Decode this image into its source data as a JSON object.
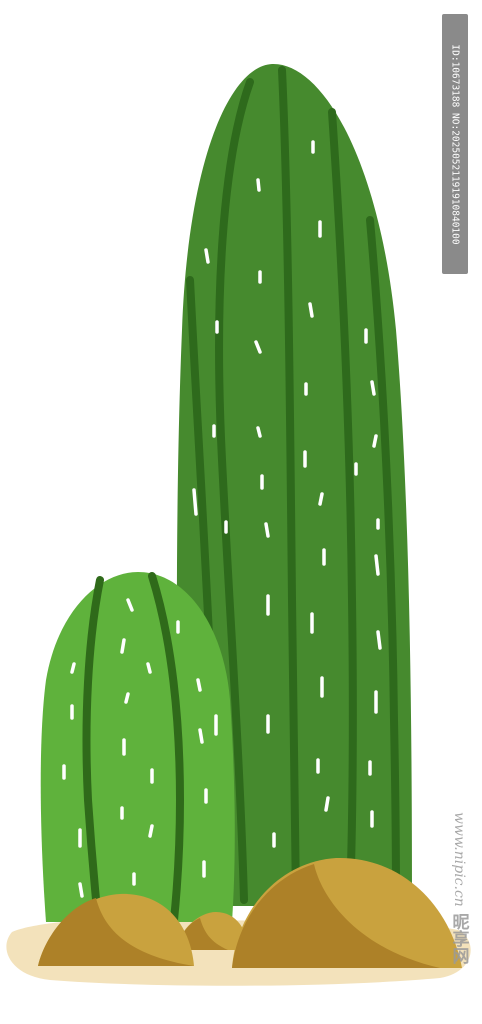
{
  "image": {
    "subject": "cactus-illustration",
    "id_label": "ID:10673188 NO:20250521191910840100",
    "watermark_site": "www.nipic.cn",
    "watermark_brand": "昵享网"
  },
  "palette": {
    "tall_cactus": "#468a2e",
    "tall_cactus_rib": "#2e6a1c",
    "small_cactus": "#5fb23c",
    "small_cactus_rib": "#2f6a1a",
    "spine": "#ffffff",
    "rock_light": "#c9a23e",
    "rock_dark": "#ad8128",
    "sand": "#f3e2bb"
  }
}
